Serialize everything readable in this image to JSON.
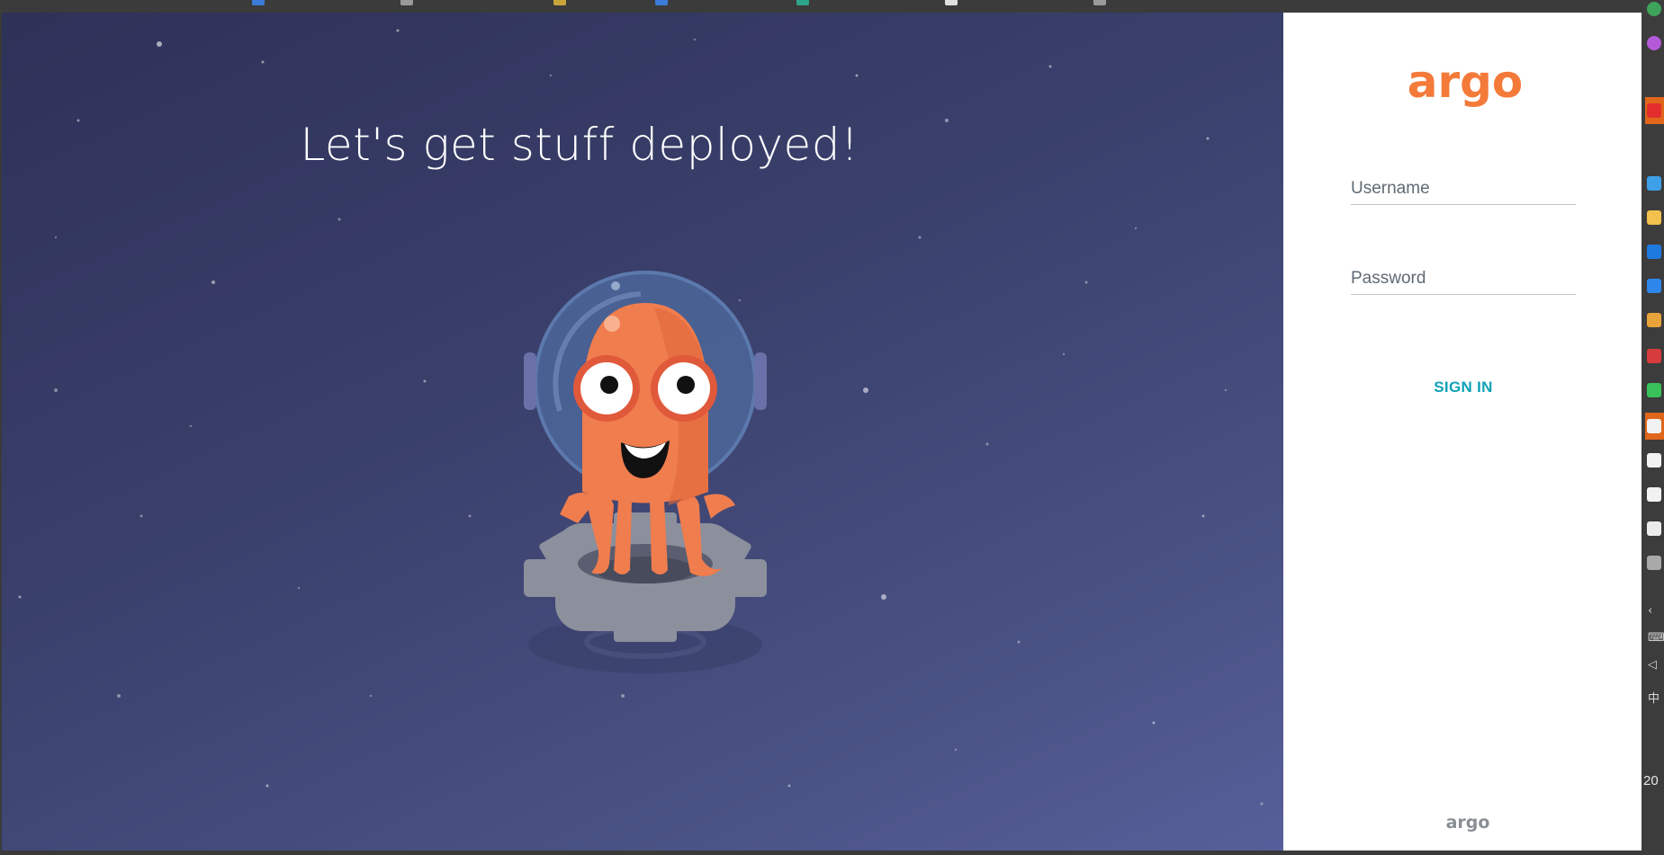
{
  "hero": {
    "title": "Let's get stuff deployed!"
  },
  "brand": {
    "logo_text": "argo",
    "footer_logo_text": "argo",
    "logo_color": "#f47a3a",
    "footer_logo_color": "#8a8f96"
  },
  "login": {
    "username_placeholder": "Username",
    "password_placeholder": "Password",
    "signin_label": "SIGN IN",
    "accent_color": "#0fa1b6"
  },
  "taskbar": {
    "clock_text": "20",
    "icons": [
      "chrome-icon",
      "messenger-icon",
      "red-app-icon",
      "download-icon",
      "folder-icon",
      "cloud-icon",
      "cloud-sync-icon",
      "tv-icon",
      "vivaldi-icon",
      "line-chat-icon",
      "penguin-icon",
      "penguin-icon",
      "penguin-icon",
      "text-app-icon",
      "image-icon",
      "chevron-left-icon",
      "keyboard-icon",
      "volume-icon",
      "ime-icon"
    ]
  }
}
